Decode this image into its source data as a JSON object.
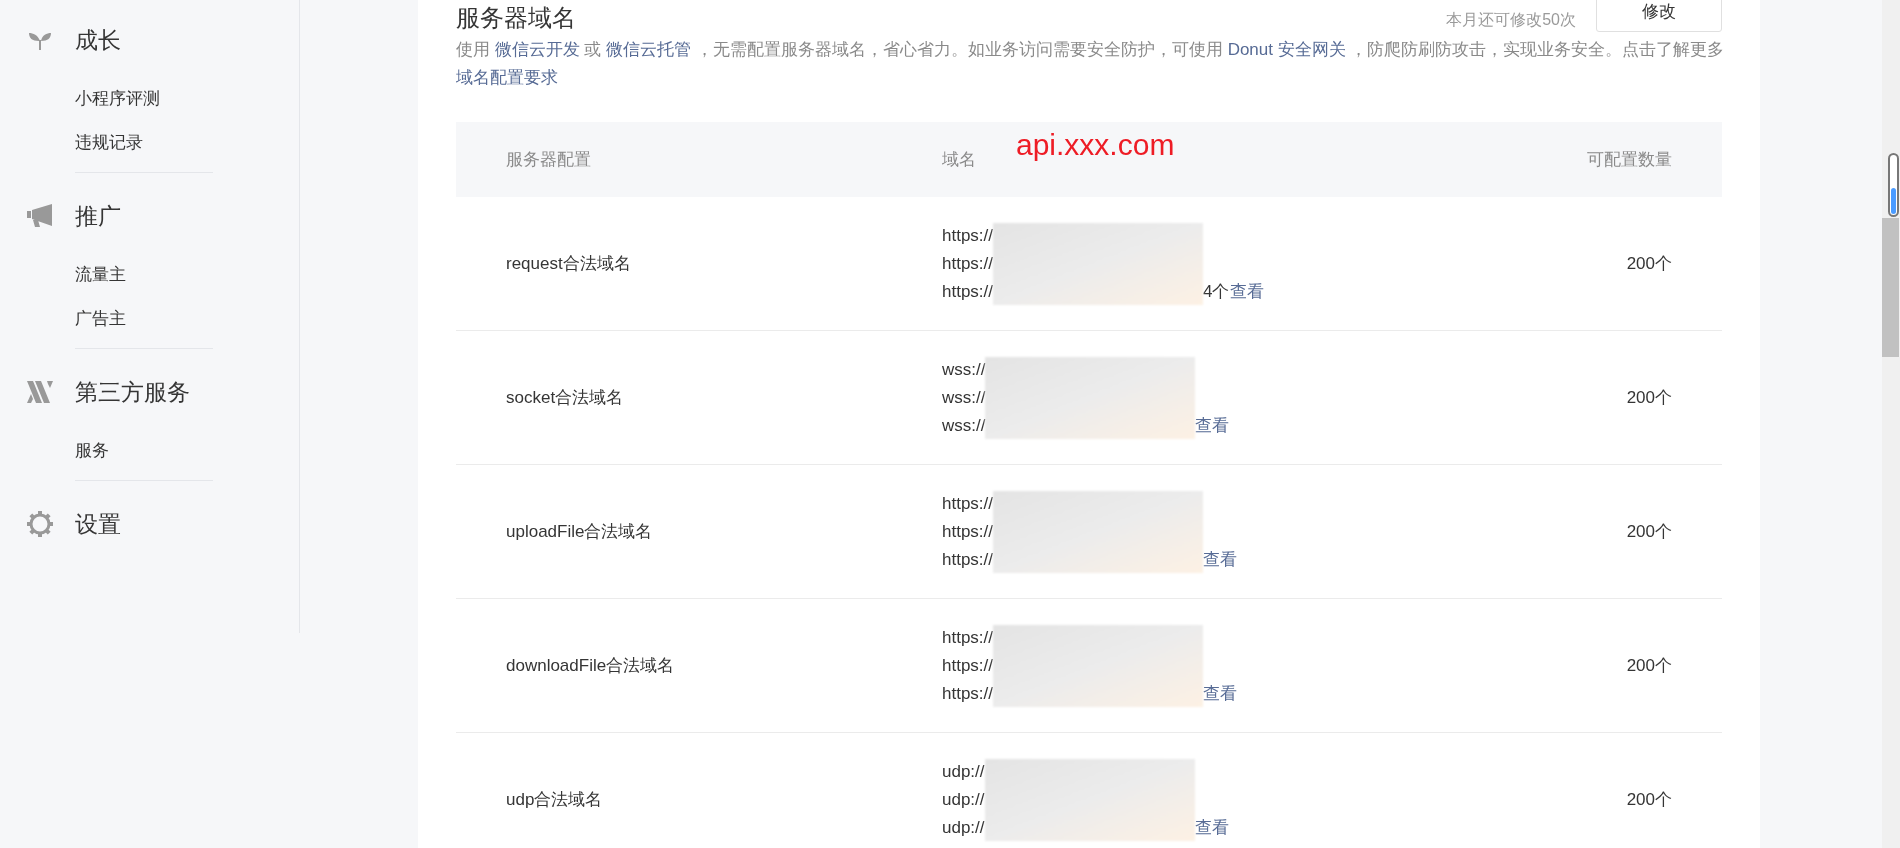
{
  "sidebar": {
    "sections": [
      {
        "title": "成长",
        "items": [
          {
            "label": "小程序评测"
          },
          {
            "label": "违规记录"
          }
        ]
      },
      {
        "title": "推广",
        "items": [
          {
            "label": "流量主"
          },
          {
            "label": "广告主"
          }
        ]
      },
      {
        "title": "第三方服务",
        "items": [
          {
            "label": "服务"
          }
        ]
      },
      {
        "title": "设置"
      }
    ]
  },
  "header": {
    "title": "服务器域名",
    "quota": "本月还可修改50次",
    "edit_button": "修改",
    "description": [
      {
        "kind": "text",
        "text": "使用 "
      },
      {
        "kind": "link",
        "text": "微信云开发"
      },
      {
        "kind": "text",
        "text": " 或 "
      },
      {
        "kind": "link",
        "text": "微信云托管"
      },
      {
        "kind": "text",
        "text": " ，无需配置服务器域名，省心省力。如业务访问需要安全防护，可使用 "
      },
      {
        "kind": "link",
        "text": "Donut 安全网关"
      },
      {
        "kind": "text",
        "text": " ，防爬防刷防攻击，实现业务安全。点击了解更多 "
      },
      {
        "kind": "link",
        "text": "域名配置要求"
      }
    ]
  },
  "annotation": "api.xxx.com",
  "table": {
    "columns": [
      "服务器配置",
      "域名",
      "可配置数量"
    ],
    "rows": [
      {
        "name": "request合法域名",
        "domains": [
          "https://",
          "https://",
          "https://"
        ],
        "suffix": "4个",
        "link": "查看",
        "count": "200个"
      },
      {
        "name": "socket合法域名",
        "domains": [
          "wss://",
          "wss://",
          "wss://"
        ],
        "link": "查看",
        "count": "200个"
      },
      {
        "name": "uploadFile合法域名",
        "domains": [
          "https://",
          "https://",
          "https://"
        ],
        "link": "查看",
        "count": "200个"
      },
      {
        "name": "downloadFile合法域名",
        "domains": [
          "https://",
          "https://",
          "https://"
        ],
        "link": "查看",
        "count": "200个"
      },
      {
        "name": "udp合法域名",
        "domains": [
          "udp://",
          "udp://",
          "udp://"
        ],
        "link": "查看",
        "count": "200个"
      }
    ]
  }
}
